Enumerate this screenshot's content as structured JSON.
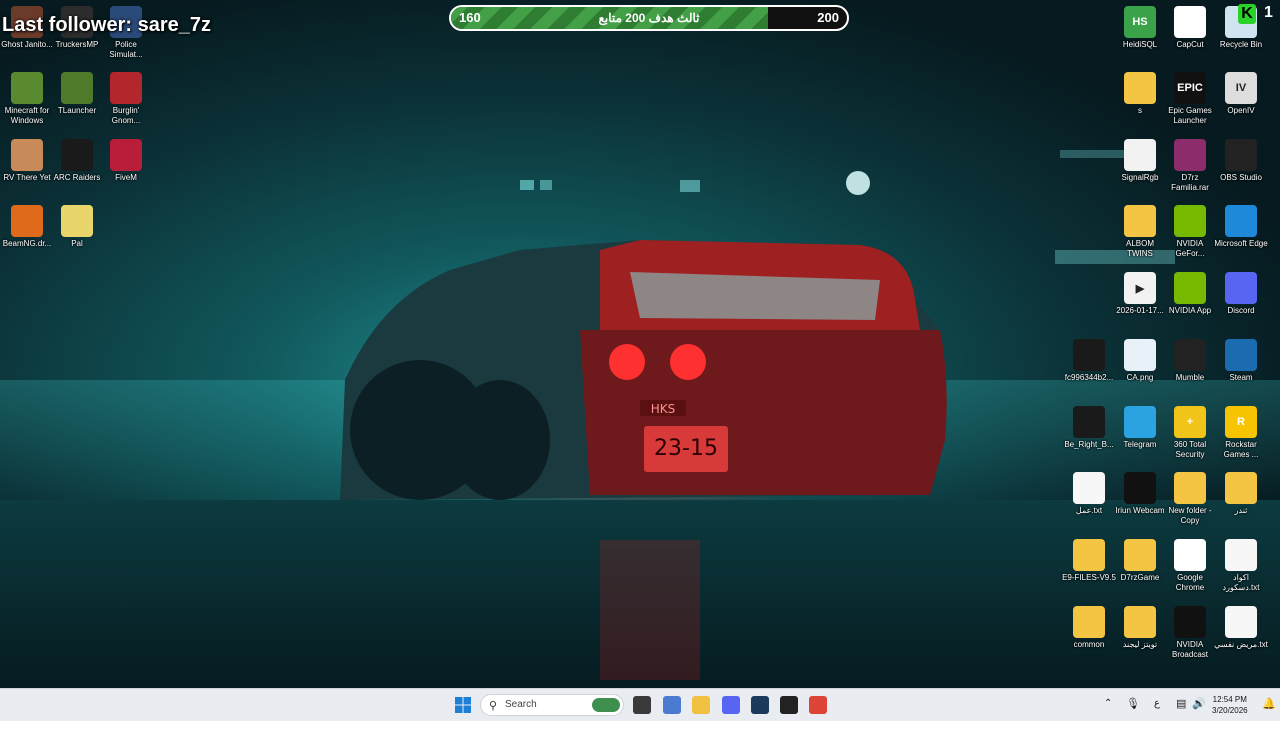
{
  "overlay": {
    "follower_text": "Last follower: sare_7z",
    "goal_left": "160",
    "goal_title": "ثالث هدف 200 متابع",
    "goal_right": "200",
    "goal_progress": 0.8,
    "corner_letter": "K",
    "corner_number": "1"
  },
  "left_icons": [
    {
      "label": "Ghost Janito...",
      "icon": "ghost-janitor-icon",
      "color": "#6b3b2a"
    },
    {
      "label": "TruckersMP",
      "icon": "truckersmp-icon",
      "color": "#2c2c2c"
    },
    {
      "label": "Police Simulat...",
      "icon": "police-simulator-icon",
      "color": "#2a4a7a"
    },
    {
      "label": "Minecraft for Windows",
      "icon": "minecraft-icon",
      "color": "#5a8a2f"
    },
    {
      "label": "TLauncher",
      "icon": "tlauncher-icon",
      "color": "#4e7a2a"
    },
    {
      "label": "Burglin' Gnom...",
      "icon": "burglin-gnomes-icon",
      "color": "#b3262b"
    },
    {
      "label": "RV There Yet",
      "icon": "rv-there-yet-icon",
      "color": "#c98a5a"
    },
    {
      "label": "ARC Raiders",
      "icon": "arc-raiders-icon",
      "color": "#1a1a1a"
    },
    {
      "label": "FiveM",
      "icon": "fivem-icon",
      "color": "#b81d3a"
    },
    {
      "label": "BeamNG.dr...",
      "icon": "beamng-icon",
      "color": "#e06a1b"
    },
    {
      "label": "Pal",
      "icon": "palworld-icon",
      "color": "#e8d66a"
    }
  ],
  "right_icons": [
    {
      "label": "HeidiSQL",
      "icon": "heidisql-icon",
      "color": "#3aa34a",
      "txt": "HS"
    },
    {
      "label": "CapCut",
      "icon": "capcut-icon",
      "color": "#ffffff",
      "txt": ""
    },
    {
      "label": "Recycle Bin",
      "icon": "recycle-bin-icon",
      "color": "#cfe3f0",
      "txt": ""
    },
    {
      "label": "s",
      "icon": "folder-icon",
      "color": "#f4c542",
      "txt": ""
    },
    {
      "label": "Epic Games Launcher",
      "icon": "epic-games-icon",
      "color": "#111111",
      "txt": "EPIC"
    },
    {
      "label": "OpenIV",
      "icon": "openiv-icon",
      "color": "#dddddd",
      "txt": "IV"
    },
    {
      "label": "SignalRgb",
      "icon": "file-icon",
      "color": "#f2f2f2",
      "txt": ""
    },
    {
      "label": "D7rz Familia.rar",
      "icon": "winrar-archive-icon",
      "color": "#8a2d6a",
      "txt": ""
    },
    {
      "label": "OBS Studio",
      "icon": "obs-studio-icon",
      "color": "#222222",
      "txt": ""
    },
    {
      "label": "ALBOM TWINS",
      "icon": "folder-icon",
      "color": "#f4c542",
      "txt": ""
    },
    {
      "label": "NVIDIA GeFor...",
      "icon": "nvidia-geforce-icon",
      "color": "#76b900",
      "txt": ""
    },
    {
      "label": "Microsoft Edge",
      "icon": "edge-icon",
      "color": "#1e88d9",
      "txt": ""
    },
    {
      "label": "2026-01-17...",
      "icon": "video-file-icon",
      "color": "#f2f2f2",
      "txt": "▶"
    },
    {
      "label": "NVIDIA App",
      "icon": "nvidia-app-icon",
      "color": "#76b900",
      "txt": ""
    },
    {
      "label": "Discord",
      "icon": "discord-icon",
      "color": "#5865f2",
      "txt": ""
    },
    {
      "label": "fc996344b2...",
      "icon": "image-file-icon",
      "color": "#1a1a1a",
      "txt": ""
    },
    {
      "label": "CA.png",
      "icon": "image-file-icon",
      "color": "#e9f1f8",
      "txt": ""
    },
    {
      "label": "Mumble",
      "icon": "mumble-icon",
      "color": "#222222",
      "txt": ""
    },
    {
      "label": "Steam",
      "icon": "steam-icon",
      "color": "#1b6bb0",
      "txt": ""
    },
    {
      "label": "Be_Right_B...",
      "icon": "image-file-icon",
      "color": "#1a1a1a",
      "txt": ""
    },
    {
      "label": "Telegram",
      "icon": "telegram-icon",
      "color": "#2aa3e0",
      "txt": ""
    },
    {
      "label": "360 Total Security",
      "icon": "360-security-icon",
      "color": "#f0c419",
      "txt": "+"
    },
    {
      "label": "Rockstar Games ...",
      "icon": "rockstar-games-icon",
      "color": "#f6c400",
      "txt": "R"
    },
    {
      "label": "عمل.txt",
      "icon": "text-file-icon",
      "color": "#f7f7f7",
      "txt": ""
    },
    {
      "label": "Iriun Webcam",
      "icon": "iriun-webcam-icon",
      "color": "#111111",
      "txt": ""
    },
    {
      "label": "New folder - Copy",
      "icon": "folder-icon",
      "color": "#f4c542",
      "txt": ""
    },
    {
      "label": "ثندر",
      "icon": "folder-icon",
      "color": "#f4c542",
      "txt": ""
    },
    {
      "label": "E9-FILES-V9.5",
      "icon": "folder-icon",
      "color": "#f4c542",
      "txt": ""
    },
    {
      "label": "D7rzGame",
      "icon": "folder-icon",
      "color": "#f4c542",
      "txt": ""
    },
    {
      "label": "Google Chrome",
      "icon": "chrome-icon",
      "color": "#ffffff",
      "txt": ""
    },
    {
      "label": "اكواد دسكورد.txt",
      "icon": "text-file-icon",
      "color": "#f7f7f7",
      "txt": ""
    },
    {
      "label": "common",
      "icon": "folder-icon",
      "color": "#f4c542",
      "txt": ""
    },
    {
      "label": "تويتز ليجند",
      "icon": "folder-icon",
      "color": "#f4c542",
      "txt": ""
    },
    {
      "label": "NVIDIA Broadcast",
      "icon": "nvidia-broadcast-icon",
      "color": "#111111",
      "txt": ""
    },
    {
      "label": "مريض نفسي.txt",
      "icon": "text-file-icon",
      "color": "#f7f7f7",
      "txt": ""
    }
  ],
  "taskbar": {
    "search_placeholder": "Search",
    "apps": [
      {
        "icon": "file-explorer-window-icon",
        "color": "#3a3a3a"
      },
      {
        "icon": "store-icon",
        "color": "#4a7bd0"
      },
      {
        "icon": "file-explorer-icon",
        "color": "#f0c040"
      },
      {
        "icon": "discord-icon",
        "color": "#5865f2"
      },
      {
        "icon": "steam-icon",
        "color": "#1b3a5c"
      },
      {
        "icon": "rockstar-launcher-icon",
        "color": "#222222"
      },
      {
        "icon": "chrome-icon",
        "color": "#db4437"
      }
    ],
    "tray_language": "ع",
    "time": "12:54 PM",
    "date": "3/20/2026"
  }
}
